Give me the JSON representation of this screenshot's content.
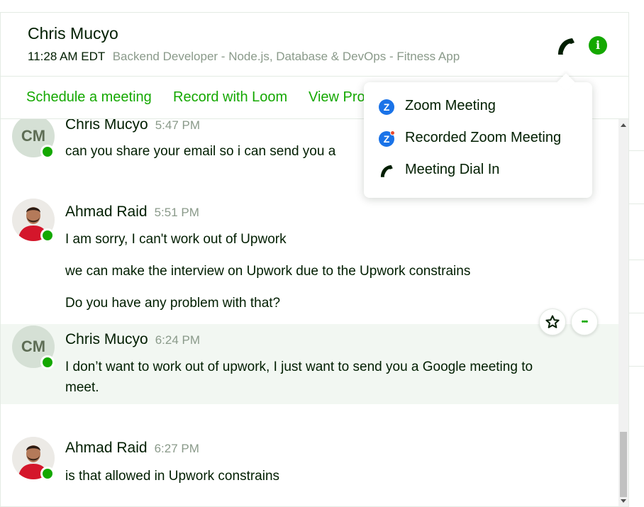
{
  "header": {
    "name": "Chris Mucyo",
    "local_time": "11:28 AM EDT",
    "job_title": "Backend Developer - Node.js, Database & DevOps - Fitness App",
    "phone_icon": "phone-icon",
    "info_icon": "info-icon",
    "info_glyph": "i"
  },
  "actions": {
    "schedule": "Schedule a meeting",
    "loom": "Record with Loom",
    "view_profile": "View Pro"
  },
  "messages": [
    {
      "initials": "CM",
      "sender": "Chris Mucyo",
      "time": "5:47 PM",
      "lines": [
        "can you share your email so i can send you a"
      ]
    },
    {
      "initials": "",
      "sender": "Ahmad Raid",
      "time": "5:51 PM",
      "lines": [
        "I am sorry, I can't work out of Upwork",
        "we can make the interview on Upwork due to the Upwork constrains",
        "Do you have any problem with that?"
      ]
    },
    {
      "initials": "CM",
      "sender": "Chris Mucyo",
      "time": "6:24 PM",
      "lines": [
        "I don’t want to work out of upwork, I just want to send you a Google meeting to",
        "meet."
      ]
    },
    {
      "initials": "",
      "sender": "Ahmad Raid",
      "time": "6:27 PM",
      "lines": [
        "is that allowed in Upwork constrains"
      ]
    }
  ],
  "hover_actions": {
    "star_icon": "star-icon",
    "more_icon": "more-icon",
    "more_glyph": "•••"
  },
  "call_menu": {
    "items": [
      {
        "label": "Zoom Meeting",
        "icon": "zoom-icon",
        "glyph": "Z"
      },
      {
        "label": "Recorded Zoom Meeting",
        "icon": "zoom-record-icon",
        "glyph": "Z"
      },
      {
        "label": "Meeting Dial In",
        "icon": "phone-icon"
      }
    ]
  },
  "colors": {
    "brand_green": "#14a800",
    "text_dark": "#001e00",
    "muted": "#8a9a8a",
    "zoom_blue": "#1a73e8"
  }
}
